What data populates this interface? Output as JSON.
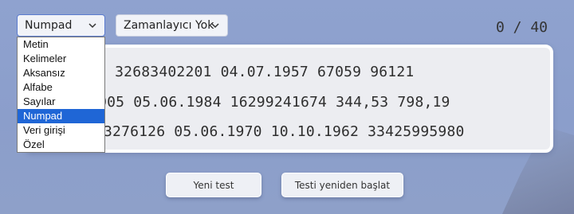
{
  "mode_select": {
    "value": "Numpad",
    "options": [
      "Metin",
      "Kelimeler",
      "Aksansız",
      "Alfabe",
      "Sayılar",
      "Numpad",
      "Veri girişi",
      "Özel"
    ],
    "selected_index": 5
  },
  "timer_select": {
    "value": "Zamanlayıcı Yok"
  },
  "counter": "0 / 40",
  "text_lines": [
    "359 32683402201 04.07.1957 67059 96121",
    "406905 05.06.1984 16299241674 344,53 798,19",
    "3276126 05.06.1970 10.10.1962 33425995980"
  ],
  "buttons": {
    "new_test": "Yeni test",
    "restart_test": "Testi yeniden başlat"
  },
  "colors": {
    "background": "#8fa2cf",
    "selected_option": "#1f66d6",
    "panel": "#ecedf1"
  }
}
